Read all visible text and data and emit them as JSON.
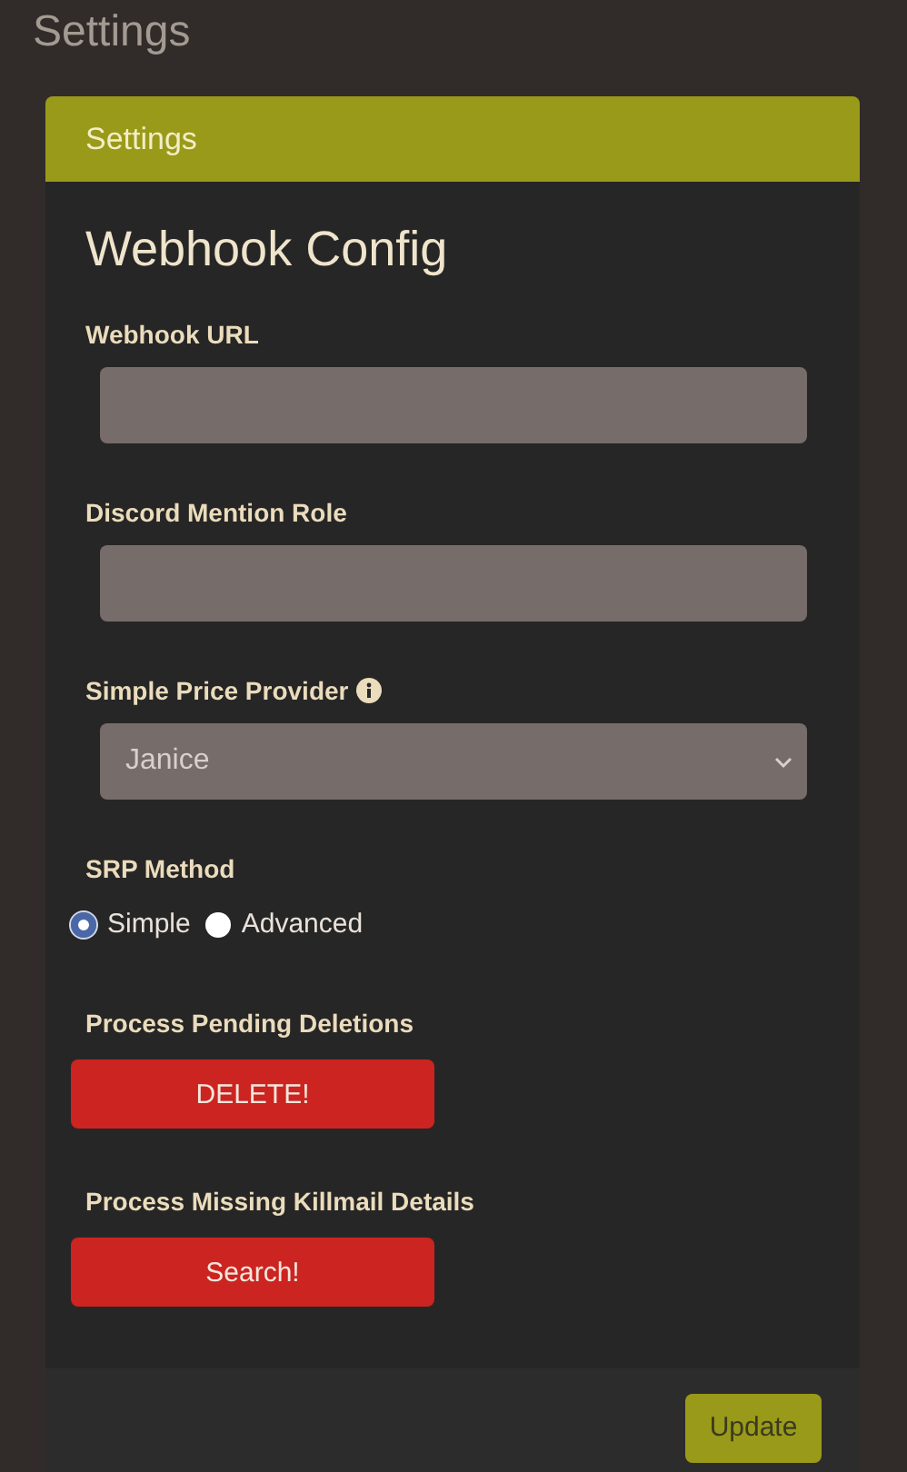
{
  "page_title": "Settings",
  "card": {
    "header": "Settings",
    "heading": "Webhook Config",
    "fields": [
      {
        "kind": "text",
        "label": "Webhook URL"
      },
      {
        "kind": "text",
        "label": "Discord Mention Role"
      },
      {
        "kind": "select",
        "label": "Simple Price Provider",
        "info": true,
        "value": "Janice"
      },
      {
        "kind": "radio",
        "label": "SRP Method",
        "options": [
          {
            "label": "Simple",
            "selected": true
          },
          {
            "label": "Advanced",
            "selected": false
          }
        ]
      },
      {
        "kind": "action",
        "label": "Process Pending Deletions",
        "button": "DELETE!"
      },
      {
        "kind": "action",
        "label": "Process Missing Killmail Details",
        "button": "Search!"
      }
    ],
    "footer_button": "Update"
  }
}
